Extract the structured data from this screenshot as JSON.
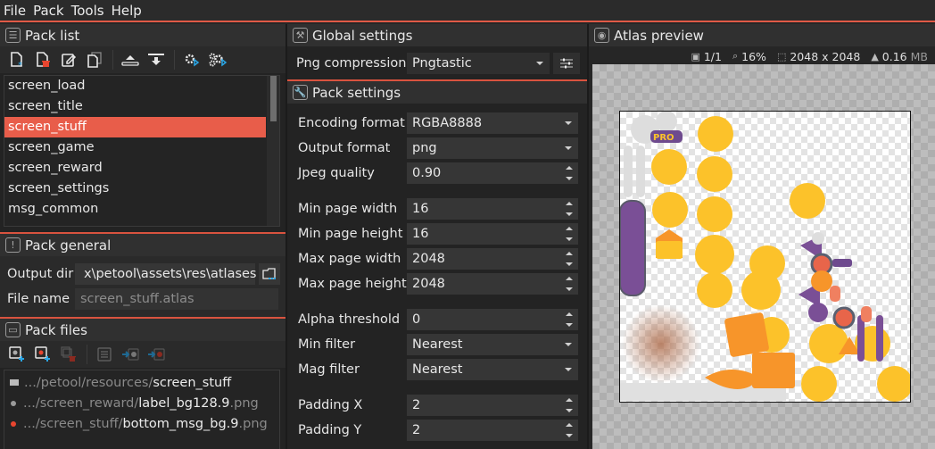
{
  "menu": [
    "File",
    "Pack",
    "Tools",
    "Help"
  ],
  "pack_list": {
    "title": "Pack list",
    "toolbar": [
      "new-pack",
      "delete-pack",
      "rename-pack",
      "duplicate-pack",
      "move-up",
      "move-down",
      "pack-selected",
      "pack-all"
    ],
    "items": [
      "screen_load",
      "screen_title",
      "screen_stuff",
      "screen_game",
      "screen_reward",
      "screen_settings",
      "msg_common"
    ],
    "selected_index": 2
  },
  "pack_general": {
    "title": "Pack general",
    "output_dir_label": "Output dir",
    "output_dir_value": "x\\petool\\assets\\res\\atlases",
    "file_name_label": "File name",
    "file_name_placeholder": "screen_stuff.atlas"
  },
  "pack_files": {
    "title": "Pack files",
    "toolbar": [
      "add-input-file",
      "add-ignore-file",
      "remove-file",
      "file-list",
      "move-to-input",
      "move-to-ignore"
    ],
    "items": [
      {
        "type": "folder",
        "prefix": ".../petool/resources/",
        "name": "screen_stuff",
        "ext": ""
      },
      {
        "type": "input",
        "prefix": ".../screen_reward/",
        "name": "label_bg128.9",
        "ext": ".png"
      },
      {
        "type": "ignore",
        "prefix": ".../screen_stuff/",
        "name": "bottom_msg_bg.9",
        "ext": ".png"
      }
    ]
  },
  "global_settings": {
    "title": "Global settings",
    "png_compression_label": "Png compression",
    "png_compression_value": "Pngtastic"
  },
  "pack_settings": {
    "title": "Pack settings",
    "encoding_format": {
      "label": "Encoding format",
      "value": "RGBA8888"
    },
    "output_format": {
      "label": "Output format",
      "value": "png"
    },
    "jpeg_quality": {
      "label": "Jpeg quality",
      "value": "0.90"
    },
    "min_page_width": {
      "label": "Min page width",
      "value": "16"
    },
    "min_page_height": {
      "label": "Min page height",
      "value": "16"
    },
    "max_page_width": {
      "label": "Max page width",
      "value": "2048"
    },
    "max_page_height": {
      "label": "Max page height",
      "value": "2048"
    },
    "alpha_threshold": {
      "label": "Alpha threshold",
      "value": "0"
    },
    "min_filter": {
      "label": "Min filter",
      "value": "Nearest"
    },
    "mag_filter": {
      "label": "Mag filter",
      "value": "Nearest"
    },
    "padding_x": {
      "label": "Padding X",
      "value": "2"
    },
    "padding_y": {
      "label": "Padding Y",
      "value": "2"
    }
  },
  "atlas_preview": {
    "title": "Atlas preview",
    "page": "1/1",
    "zoom": "16%",
    "size": "2048 x 2048",
    "file_size": "0.16",
    "file_size_unit": "MB"
  },
  "colors": {
    "accent": "#e85d4a",
    "input_dot": "#9a9a9a",
    "ignore_dot": "#e8452f",
    "sprite_yellow": "#fcc22a",
    "sprite_orange": "#f7952a",
    "sprite_purple": "#7a4f96"
  }
}
